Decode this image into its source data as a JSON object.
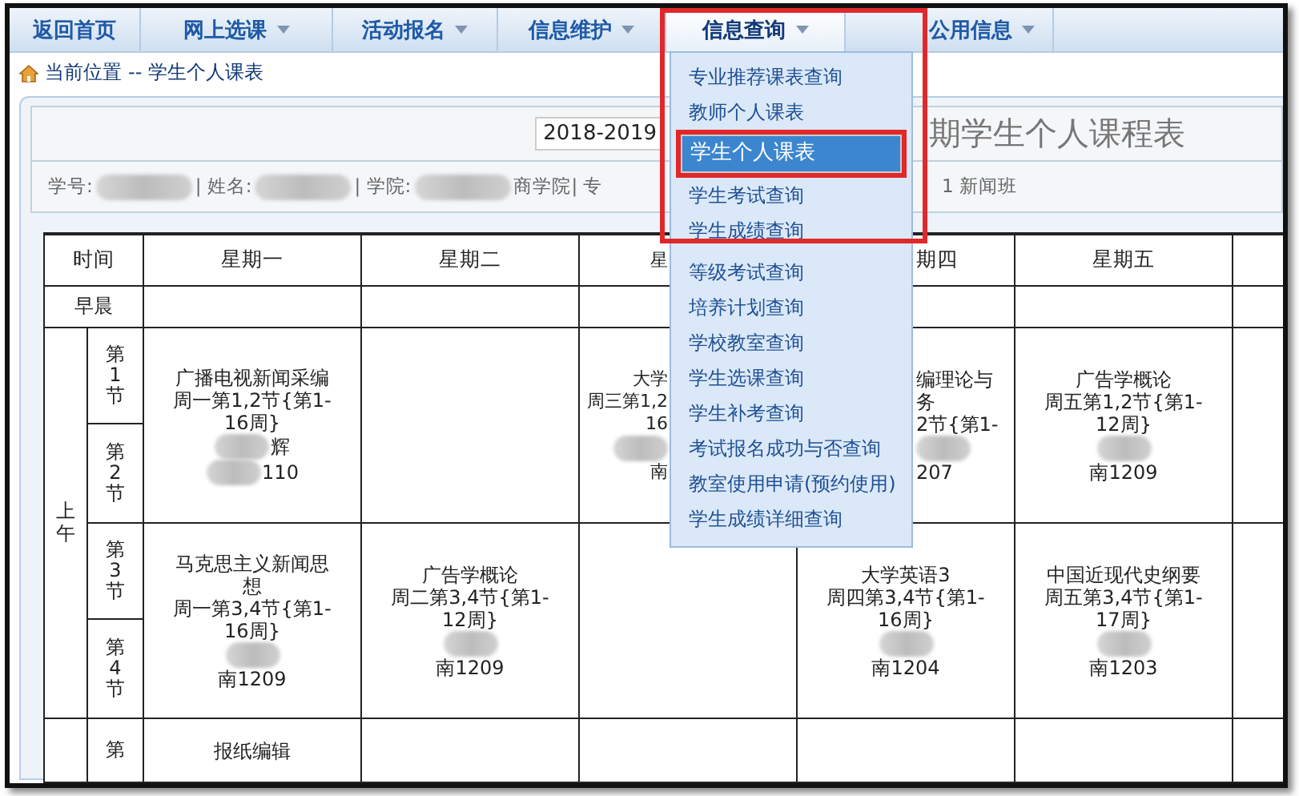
{
  "nav": [
    {
      "label": "返回首页",
      "has_menu": false,
      "active": false,
      "highlighted": false
    },
    {
      "label": "网上选课",
      "has_menu": true,
      "active": false,
      "highlighted": false
    },
    {
      "label": "活动报名",
      "has_menu": true,
      "active": false,
      "highlighted": false
    },
    {
      "label": "信息维护",
      "has_menu": true,
      "active": false,
      "highlighted": false
    },
    {
      "label": "信息查询",
      "has_menu": true,
      "active": true,
      "highlighted": true,
      "menu": [
        {
          "label": "专业推荐课表查询",
          "selected": false,
          "highlighted": false
        },
        {
          "label": "教师个人课表",
          "selected": false,
          "highlighted": false
        },
        {
          "label": "学生个人课表",
          "selected": true,
          "highlighted": true
        },
        {
          "label": "学生考试查询",
          "selected": false,
          "highlighted": false
        },
        {
          "label": "学生成绩查询",
          "selected": false,
          "highlighted": false
        },
        {
          "label": "等级考试查询",
          "selected": false,
          "highlighted": false
        },
        {
          "label": "培养计划查询",
          "selected": false,
          "highlighted": false
        },
        {
          "label": "学校教室查询",
          "selected": false,
          "highlighted": false
        },
        {
          "label": "学生选课查询",
          "selected": false,
          "highlighted": false
        },
        {
          "label": "学生补考查询",
          "selected": false,
          "highlighted": false
        },
        {
          "label": "考试报名成功与否查询",
          "selected": false,
          "highlighted": false
        },
        {
          "label": "教室使用申请(预约使用)",
          "selected": false,
          "highlighted": false
        },
        {
          "label": "学生成绩详细查询",
          "selected": false,
          "highlighted": false
        }
      ]
    },
    {
      "label": "公用信息",
      "has_menu": true,
      "active": false,
      "highlighted": false
    }
  ],
  "breadcrumb": {
    "label": "当前位置",
    "path": "-- 学生个人课表"
  },
  "term_select": {
    "value": "2018-2019"
  },
  "title": "期学生个人课程表",
  "student_info": {
    "left": [
      {
        "text": "学号:",
        "blurred": false
      },
      {
        "blurred": true
      },
      {
        "text": "| 姓名:",
        "blurred": false
      },
      {
        "blurred": true
      },
      {
        "text": "| 学院:",
        "blurred": false
      },
      {
        "blurred": true
      },
      {
        "text": "商学院| 专",
        "blurred": false
      }
    ],
    "right": [
      {
        "text": "1 新闻班",
        "blurred": false
      }
    ]
  },
  "timetable": {
    "columns": [
      "时间",
      "星期一",
      "星期二",
      "星",
      "期四",
      "星期五"
    ],
    "morning_label": "早晨",
    "section_label": "上午",
    "slots": [
      {
        "periods": [
          "第1节",
          "第2节"
        ],
        "cells": [
          {
            "kind": "course",
            "lines": [
              {
                "text": "广播电视新闻采编",
                "blurred": false
              },
              {
                "text": "周一第1,2节{第1-",
                "blurred": false
              },
              {
                "text": "16周}",
                "blurred": false
              },
              {
                "text": "辉",
                "blurred": true
              },
              {
                "text": "110",
                "blurred": true
              }
            ]
          },
          {
            "kind": "empty"
          },
          {
            "kind": "course",
            "lines": [
              {
                "text": "大学",
                "blurred": false
              },
              {
                "text": "周三第1,2",
                "blurred": false
              },
              {
                "text": "16",
                "blurred": false
              },
              {
                "blurred": true
              },
              {
                "text": "南",
                "blurred": false
              }
            ]
          },
          {
            "kind": "course",
            "lines": [
              {
                "text": "编理论与",
                "blurred": false
              },
              {
                "text": "务",
                "blurred": false
              },
              {
                "text": "2节{第1-",
                "blurred": false
              },
              {
                "blurred": true
              },
              {
                "text": "207",
                "blurred": false
              }
            ]
          },
          {
            "kind": "course",
            "lines": [
              {
                "text": "广告学概论",
                "blurred": false
              },
              {
                "text": "周五第1,2节{第1-",
                "blurred": false
              },
              {
                "text": "12周}",
                "blurred": false
              },
              {
                "blurred": true
              },
              {
                "text": "南1209",
                "blurred": false
              }
            ]
          }
        ]
      },
      {
        "periods": [
          "第3节",
          "第4节"
        ],
        "cells": [
          {
            "kind": "course",
            "lines": [
              {
                "text": "马克思主义新闻思",
                "blurred": false
              },
              {
                "text": "想",
                "blurred": false
              },
              {
                "text": "周一第3,4节{第1-",
                "blurred": false
              },
              {
                "text": "16周}",
                "blurred": false
              },
              {
                "blurred": true
              },
              {
                "text": "南1209",
                "blurred": false
              }
            ]
          },
          {
            "kind": "course",
            "lines": [
              {
                "text": "广告学概论",
                "blurred": false
              },
              {
                "text": "周二第3,4节{第1-",
                "blurred": false
              },
              {
                "text": "12周}",
                "blurred": false
              },
              {
                "blurred": true
              },
              {
                "text": "南1209",
                "blurred": false
              }
            ]
          },
          {
            "kind": "empty"
          },
          {
            "kind": "course",
            "lines": [
              {
                "text": "大学英语3",
                "blurred": false
              },
              {
                "text": "周四第3,4节{第1-",
                "blurred": false
              },
              {
                "text": "16周}",
                "blurred": false
              },
              {
                "blurred": true
              },
              {
                "text": "南1204",
                "blurred": false
              }
            ]
          },
          {
            "kind": "course",
            "lines": [
              {
                "text": "中国近现代史纲要",
                "blurred": false
              },
              {
                "text": "周五第3,4节{第1-",
                "blurred": false
              },
              {
                "text": "17周}",
                "blurred": false
              },
              {
                "blurred": true
              },
              {
                "text": "南1203",
                "blurred": false
              }
            ]
          }
        ]
      },
      {
        "periods": [
          "第"
        ],
        "cells": [
          {
            "kind": "course",
            "lines": [
              {
                "text": "报纸编辑",
                "blurred": false
              }
            ]
          },
          {
            "kind": "empty"
          },
          {
            "kind": "empty"
          },
          {
            "kind": "empty"
          },
          {
            "kind": "empty"
          }
        ]
      }
    ]
  }
}
